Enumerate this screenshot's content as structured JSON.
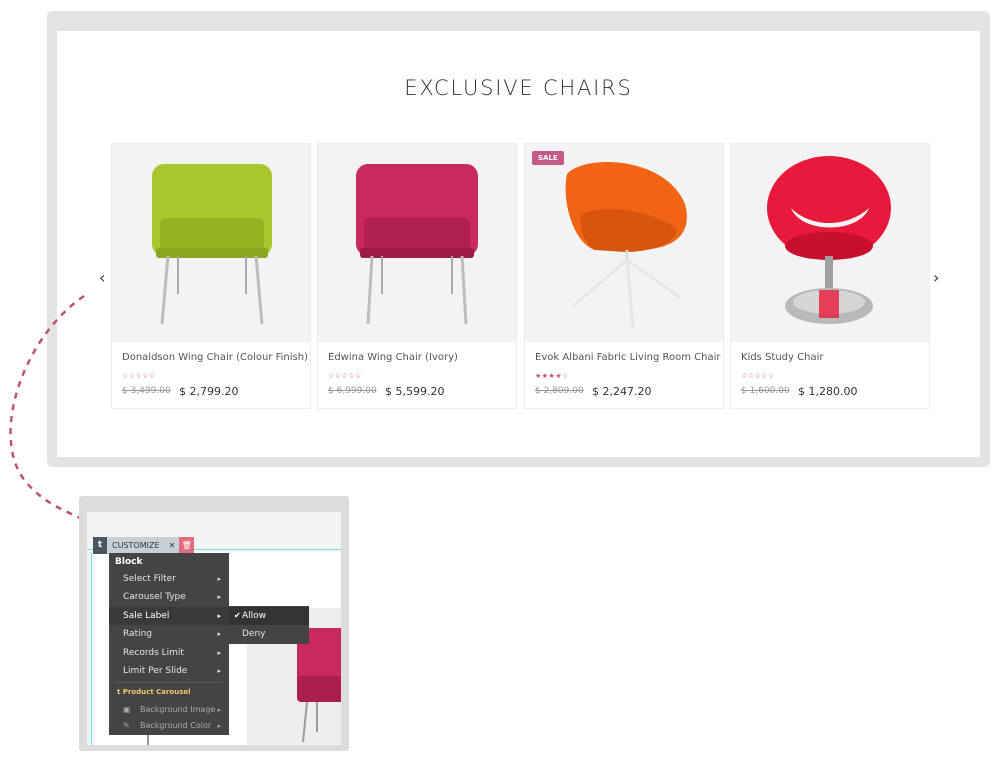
{
  "section": {
    "title": "EXCLUSIVE CHAIRS"
  },
  "carousel": {
    "prev_icon": "chevron-left-icon",
    "next_icon": "chevron-right-icon",
    "prev_glyph": "‹",
    "next_glyph": "›"
  },
  "products": [
    {
      "name": "Donaldson Wing Chair (Colour Finish)",
      "stars": "☆☆☆☆☆",
      "old_price": "$ 3,499.00",
      "price": "$ 2,799.20",
      "color": "#a9c62b",
      "sale": false
    },
    {
      "name": "Edwina Wing Chair (Ivory)",
      "stars": "☆☆☆☆☆",
      "old_price": "$ 6,999.00",
      "price": "$ 5,599.20",
      "color": "#c9295f",
      "sale": false
    },
    {
      "name": "Evok Albani Fabric Living Room Chair",
      "stars": "★★★★☆",
      "old_price": "$ 2,809.00",
      "price": "$ 2,247.20",
      "color": "#f06413",
      "sale": true,
      "sale_label": "SALE"
    },
    {
      "name": "Kids Study Chair",
      "stars": "☆☆☆☆☆",
      "old_price": "$ 1,600.00",
      "price": "$ 1,280.00",
      "color": "#e8193a",
      "sale": false
    }
  ],
  "toolbar": {
    "logo": "t",
    "customize_label": "CUSTOMIZE",
    "close_glyph": "✕",
    "delete_glyph": "🗑"
  },
  "menu": {
    "header": "Block",
    "items": [
      {
        "label": "Select Filter",
        "arrow": "▸"
      },
      {
        "label": "Carousel Type",
        "arrow": "▸"
      },
      {
        "label": "Sale Label",
        "arrow": "▸",
        "active": true
      },
      {
        "label": "Rating",
        "arrow": "▸"
      },
      {
        "label": "Records Limit",
        "arrow": "▸"
      },
      {
        "label": "Limit Per Slide",
        "arrow": "▸"
      }
    ],
    "sub_header": "t  Product Carousel",
    "sub_items": [
      {
        "icon": "image-icon",
        "glyph": "▣",
        "label": "Background Image",
        "arrow": "▸"
      },
      {
        "icon": "color-picker-icon",
        "glyph": "✎",
        "label": "Background Color",
        "arrow": "▸"
      }
    ]
  },
  "submenu": {
    "options": [
      {
        "label": "Allow",
        "check": "✔",
        "selected": true
      },
      {
        "label": "Deny",
        "check": "",
        "selected": false
      }
    ]
  },
  "colors": {
    "accent": "#c0516f",
    "connector": "#c0516f",
    "preview_chair": "#c9295f"
  }
}
